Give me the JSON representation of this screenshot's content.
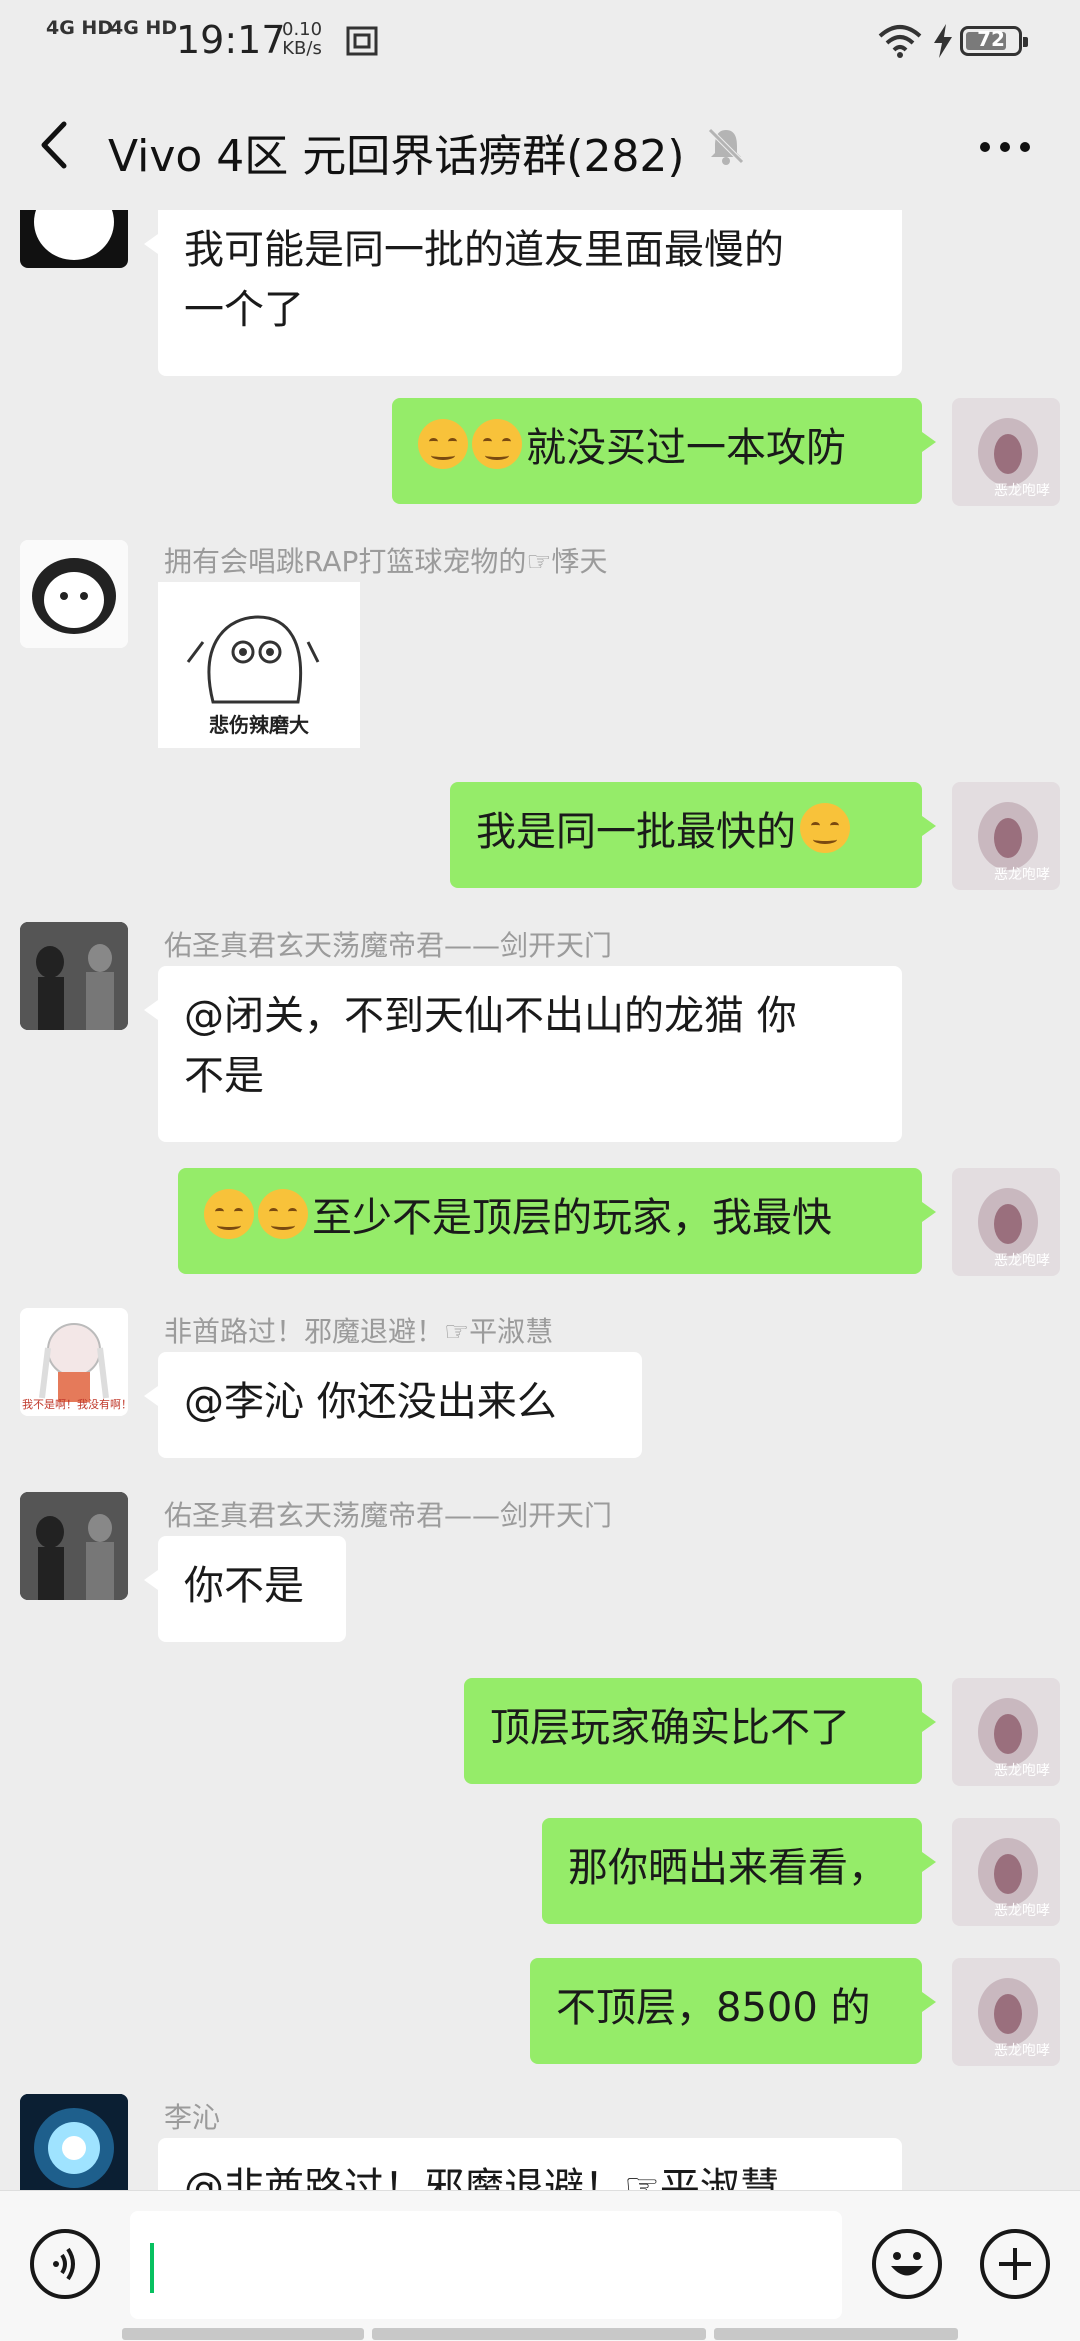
{
  "status": {
    "net1": "4G HD",
    "net2": "4G HD",
    "time": "19:17",
    "speed_value": "0.10",
    "speed_unit": "KB/s",
    "battery": "72"
  },
  "header": {
    "title": "Vivo 4区 元回界话痨群(282)"
  },
  "messages": [
    {
      "side": "left",
      "nick": "",
      "text_lines": [
        "我可能是同一批的道友里面最慢的",
        "一个了"
      ]
    },
    {
      "side": "right",
      "emoji_count": 2,
      "text": "就没买过一本攻防",
      "avatar_caption": "恶龙咆哮"
    },
    {
      "side": "left",
      "nick": "拥有会唱跳RAP打篮球宠物的☞悸天",
      "sticker_caption": "悲伤辣磨大"
    },
    {
      "side": "right",
      "text": "我是同一批最快的",
      "emoji_after": 1,
      "avatar_caption": "恶龙咆哮"
    },
    {
      "side": "left",
      "nick": "佑圣真君玄天荡魔帝君——剑开天门",
      "text_lines": [
        "@闭关，不到天仙不出山的龙猫  你",
        "不是"
      ]
    },
    {
      "side": "right",
      "emoji_count": 2,
      "text": "至少不是顶层的玩家，我最快",
      "avatar_caption": "恶龙咆哮"
    },
    {
      "side": "left",
      "nick": "非酋路过！邪魔退避！☞平淑慧",
      "text": "@李沁  你还没出来么",
      "avatar_caption": "我不是啊！我没有啊！"
    },
    {
      "side": "left",
      "nick": "佑圣真君玄天荡魔帝君——剑开天门",
      "text": "你不是"
    },
    {
      "side": "right",
      "text": "顶层玩家确实比不了",
      "avatar_caption": "恶龙咆哮"
    },
    {
      "side": "right",
      "text": "那你晒出来看看，",
      "avatar_caption": "恶龙咆哮"
    },
    {
      "side": "right",
      "text": "不顶层，8500 的",
      "avatar_caption": "恶龙咆哮"
    },
    {
      "side": "left",
      "nick": "李沁",
      "text": "@非酋路过！邪魔退避！☞平淑慧"
    }
  ],
  "input": {
    "voice_icon": "voice-icon",
    "emoji_icon": "emoji-icon",
    "plus_icon": "plus-icon"
  }
}
